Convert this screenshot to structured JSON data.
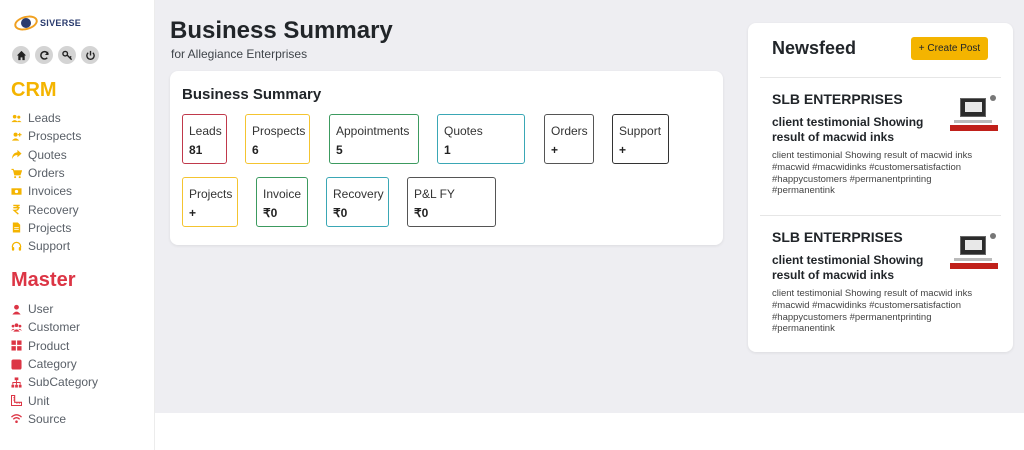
{
  "brand": {
    "logo_text": "SIVERSE"
  },
  "quick_icons": [
    "home-icon",
    "refresh-icon",
    "key-icon",
    "power-icon"
  ],
  "sidebar": {
    "crm_title": "CRM",
    "crm_items": [
      {
        "label": "Leads",
        "icon": "users-icon"
      },
      {
        "label": "Prospects",
        "icon": "user-plus-icon"
      },
      {
        "label": "Quotes",
        "icon": "share-arrow-icon"
      },
      {
        "label": "Orders",
        "icon": "cart-icon"
      },
      {
        "label": "Invoices",
        "icon": "money-bill-icon"
      },
      {
        "label": "Recovery",
        "icon": "rupee-icon"
      },
      {
        "label": "Projects",
        "icon": "file-icon"
      },
      {
        "label": "Support",
        "icon": "headset-icon"
      }
    ],
    "master_title": "Master",
    "master_items": [
      {
        "label": "User",
        "icon": "user-icon"
      },
      {
        "label": "Customer",
        "icon": "users-icon"
      },
      {
        "label": "Product",
        "icon": "grid-icon"
      },
      {
        "label": "Category",
        "icon": "square-icon"
      },
      {
        "label": "SubCategory",
        "icon": "sitemap-icon"
      },
      {
        "label": "Unit",
        "icon": "ruler-icon"
      },
      {
        "label": "Source",
        "icon": "wifi-icon"
      }
    ],
    "crm_color": "#f4b400",
    "master_color": "#dc3545"
  },
  "header": {
    "title": "Business Summary",
    "subtitle": "for Allegiance Enterprises"
  },
  "summary": {
    "title": "Business Summary",
    "tiles": [
      {
        "label": "Leads",
        "value": "81",
        "color": "#c0394b"
      },
      {
        "label": "Prospects",
        "value": "6",
        "color": "#f4c430"
      },
      {
        "label": "Appointments",
        "value": "5",
        "color": "#3c9a5f"
      },
      {
        "label": "Quotes",
        "value": "1",
        "color": "#3aa7b5"
      },
      {
        "label": "Orders",
        "value": "+",
        "color": "#555555"
      },
      {
        "label": "Support",
        "value": "+",
        "color": "#333333"
      },
      {
        "label": "Projects",
        "value": "+",
        "color": "#f4c430"
      },
      {
        "label": "Invoice",
        "value": "₹0",
        "color": "#3c9a5f"
      },
      {
        "label": "Recovery",
        "value": "₹0",
        "color": "#3aa7b5"
      },
      {
        "label": "P&L FY",
        "value": "₹0",
        "color": "#555555"
      }
    ]
  },
  "newsfeed": {
    "title": "Newsfeed",
    "create_label": "+ Create Post",
    "posts": [
      {
        "company": "SLB ENTERPRISES",
        "headline": "client testimonial Showing result of macwid inks",
        "body": "client testimonial Showing result of macwid inks #macwid #macwidinks #customersatisfaction #happycustomers #permanentprinting #permanentink"
      },
      {
        "company": "SLB ENTERPRISES",
        "headline": "client testimonial Showing result of macwid inks",
        "body": "client testimonial Showing result of macwid inks #macwid #macwidinks #customersatisfaction #happycustomers #permanentprinting #permanentink"
      }
    ]
  }
}
